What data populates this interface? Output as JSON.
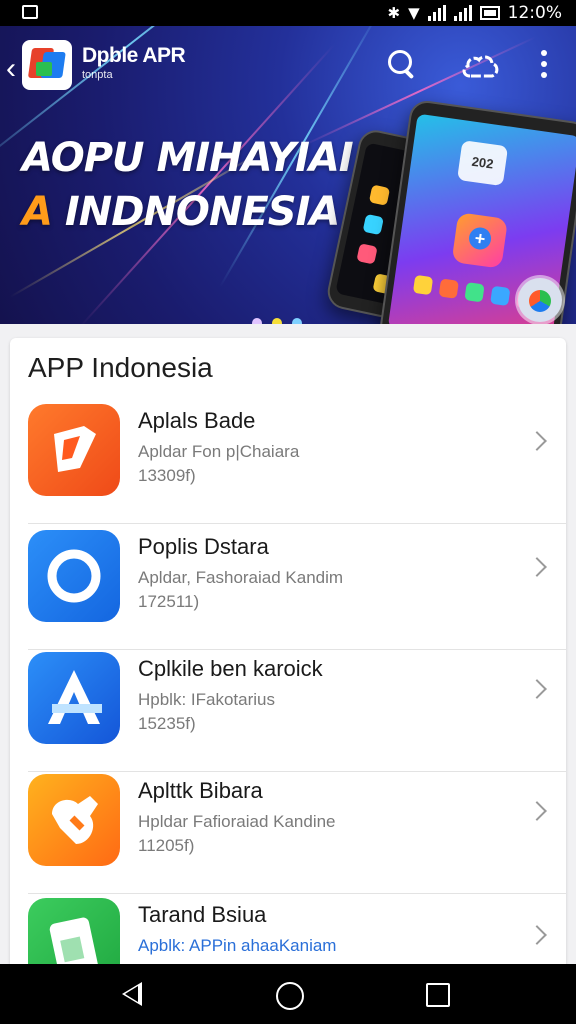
{
  "status_bar": {
    "time": "12:0%"
  },
  "header": {
    "brand_name": "Dpble APR",
    "brand_sub": "tonpta"
  },
  "banner": {
    "line1": "AOPU MIHAYIAI",
    "line2_accent": "A",
    "line2_rest": " INDNONESIA",
    "phone_clock": "202",
    "dot_colors": [
      "#e0c4ff",
      "#f6de38",
      "#7fd0ff"
    ]
  },
  "section": {
    "title": "APP Indonesia"
  },
  "apps": [
    {
      "title": "Aplals Bade",
      "subtitle": "Apldar Fon p|Chaiara",
      "size": "13309f)",
      "icon": "orange-pencil-icon",
      "color": "#ff5a1f"
    },
    {
      "title": "Poplis Dstara",
      "subtitle": "Apldar, Fashoraiad Kandim",
      "size": "172511)",
      "icon": "blue-ring-icon",
      "color": "#1d7cf0"
    },
    {
      "title": "Cplkile ben karoick",
      "subtitle": "Hpblk: IFakotarius",
      "size": "15235f)",
      "icon": "app-store-a-icon",
      "color": "#1a72e8"
    },
    {
      "title": "Aplttk Bibara",
      "subtitle": "Hpldar Fafioraiad Kandine",
      "size": "11205f)",
      "icon": "orange-wrench-icon",
      "color": "#ff7a18"
    },
    {
      "title": "Tarand Bsiua",
      "subtitle": "Apblk: APPin ahaaKaniam",
      "size": "",
      "icon": "green-phone-icon",
      "color": "#2bb84a"
    }
  ]
}
